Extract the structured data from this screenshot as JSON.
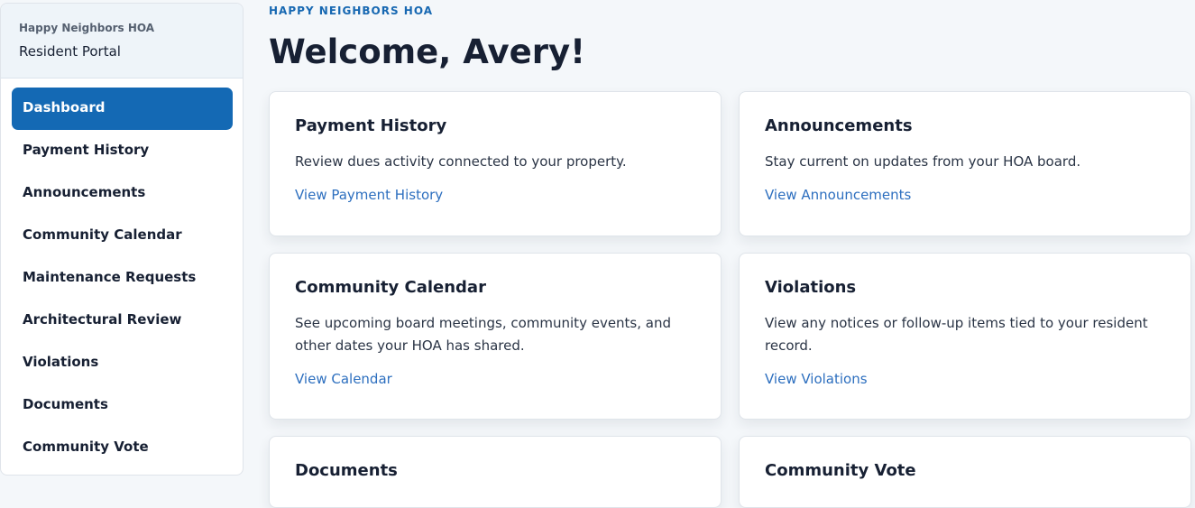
{
  "sidebar": {
    "org_name": "Happy Neighbors HOA",
    "portal_title": "Resident Portal",
    "items": [
      {
        "label": "Dashboard",
        "active": true
      },
      {
        "label": "Payment History"
      },
      {
        "label": "Announcements"
      },
      {
        "label": "Community Calendar"
      },
      {
        "label": "Maintenance Requests"
      },
      {
        "label": "Architectural Review"
      },
      {
        "label": "Violations"
      },
      {
        "label": "Documents"
      },
      {
        "label": "Community Vote"
      }
    ]
  },
  "header": {
    "eyebrow": "HAPPY NEIGHBORS HOA",
    "title": "Welcome, Avery!"
  },
  "cards": [
    {
      "title": "Payment History",
      "description": "Review dues activity connected to your property.",
      "link": "View Payment History"
    },
    {
      "title": "Announcements",
      "description": "Stay current on updates from your HOA board.",
      "link": "View Announcements"
    },
    {
      "title": "Community Calendar",
      "description": "See upcoming board meetings, community events, and other dates your HOA has shared.",
      "link": "View Calendar"
    },
    {
      "title": "Violations",
      "description": "View any notices or follow-up items tied to your resident record.",
      "link": "View Violations"
    },
    {
      "title": "Documents"
    },
    {
      "title": "Community Vote"
    }
  ],
  "colors": {
    "accent": "#1469b4",
    "link": "#2d6fbf",
    "background": "#f4f7fa"
  }
}
